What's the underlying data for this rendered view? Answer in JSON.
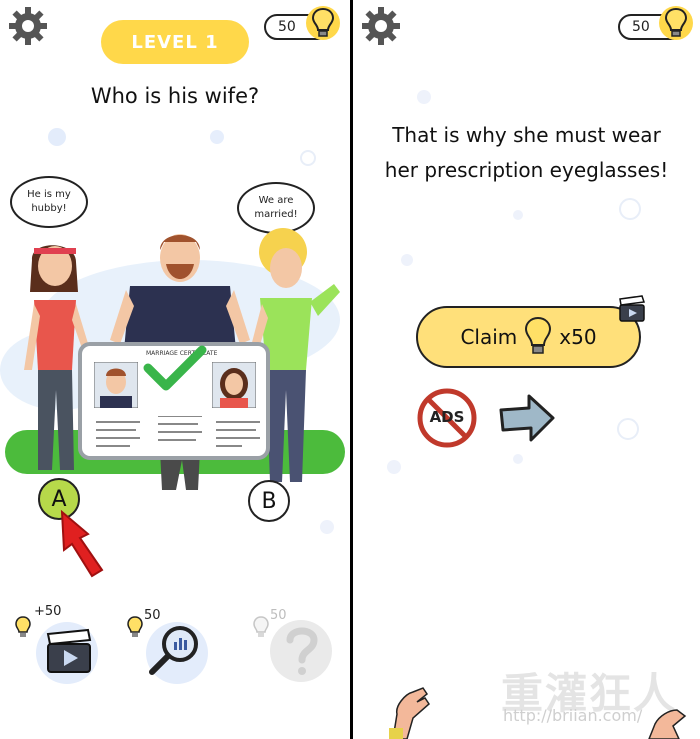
{
  "left_screen": {
    "bulb_count": "50",
    "level_label": "LEVEL 1",
    "question": "Who is his wife?",
    "bubble_left": "He is my hubby!",
    "bubble_right": "We are married!",
    "certificate_title": "MARRIAGE CERTIFICATE",
    "answer_a": "A",
    "answer_b": "B",
    "hint_video_cost": "+50",
    "hint_search_cost": "50",
    "hint_question_cost": "50"
  },
  "right_screen": {
    "bulb_count": "50",
    "message": "That is why she must wear her prescription eyeglasses!",
    "claim_label": "Claim",
    "claim_multiplier": "x50",
    "no_ads_label": "ADS"
  },
  "watermark": {
    "site_name": "重灌狂人",
    "url": "http://briian.com/"
  },
  "colors": {
    "accent_yellow": "#ffd84a",
    "check_green": "#39b54a",
    "answer_a_fill": "#b7d94a",
    "arrow_red": "#e02020",
    "grass_green": "#4cbb3c"
  }
}
